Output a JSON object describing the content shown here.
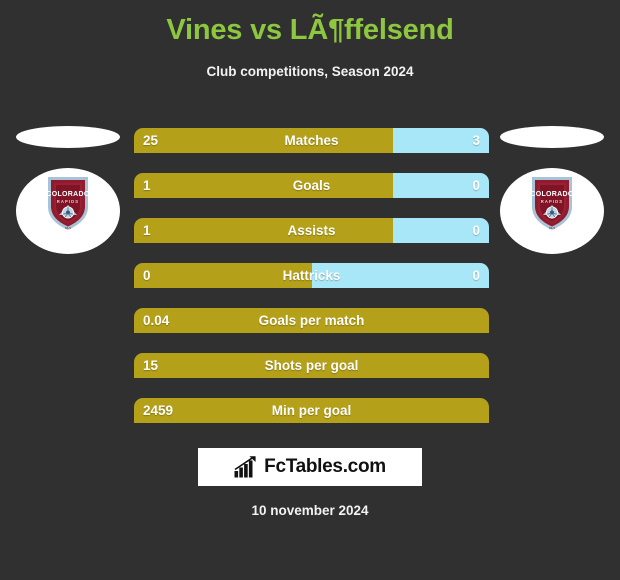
{
  "header": {
    "title": "Vines vs LÃ¶ffelsend",
    "subtitle": "Club competitions, Season 2024"
  },
  "teams": {
    "home": {
      "badge_name": "Colorado Rapids",
      "crest_text_top": "COLORADO",
      "crest_text_bottom": "RAPIDS"
    },
    "away": {
      "badge_name": "Colorado Rapids",
      "crest_text_top": "COLORADO",
      "crest_text_bottom": "RAPIDS"
    }
  },
  "colors": {
    "background": "#303030",
    "title": "#8DC63F",
    "home_bar": "#B5A019",
    "away_bar": "#A8E7F8",
    "text": "#ffffff",
    "panel": "#ffffff"
  },
  "stats": [
    {
      "label": "Matches",
      "home": "25",
      "away": "3",
      "home_pct": 73,
      "split": true
    },
    {
      "label": "Goals",
      "home": "1",
      "away": "0",
      "home_pct": 73,
      "split": true
    },
    {
      "label": "Assists",
      "home": "1",
      "away": "0",
      "home_pct": 73,
      "split": true
    },
    {
      "label": "Hattricks",
      "home": "0",
      "away": "0",
      "home_pct": 50,
      "split": true
    },
    {
      "label": "Goals per match",
      "home": "0.04",
      "away": "",
      "home_pct": 100,
      "split": false
    },
    {
      "label": "Shots per goal",
      "home": "15",
      "away": "",
      "home_pct": 100,
      "split": false
    },
    {
      "label": "Min per goal",
      "home": "2459",
      "away": "",
      "home_pct": 100,
      "split": false
    }
  ],
  "footer": {
    "logo_text": "FcTables.com",
    "logo_icon": "bar-chart-arrow-icon",
    "date": "10 november 2024"
  },
  "chart_data": {
    "type": "bar",
    "title": "Vines vs LÃ¶ffelsend",
    "subtitle": "Club competitions, Season 2024",
    "categories": [
      "Matches",
      "Goals",
      "Assists",
      "Hattricks",
      "Goals per match",
      "Shots per goal",
      "Min per goal"
    ],
    "series": [
      {
        "name": "Vines",
        "values": [
          25,
          1,
          1,
          0,
          0.04,
          15,
          2459
        ]
      },
      {
        "name": "LÃ¶ffelsend",
        "values": [
          3,
          0,
          0,
          0,
          null,
          null,
          null
        ]
      }
    ],
    "orientation": "horizontal",
    "grid": false,
    "legend": "none",
    "xlabel": "",
    "ylabel": ""
  }
}
